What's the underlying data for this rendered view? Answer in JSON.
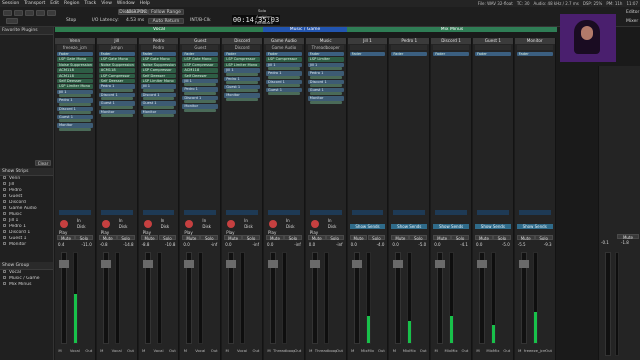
{
  "menu": [
    "Session",
    "Transport",
    "Edit",
    "Region",
    "Track",
    "View",
    "Window",
    "Help"
  ],
  "status": {
    "file": "File: WAV 32-float",
    "tc": "TC: 30",
    "audio": "Audio: 48 kHz / 2.7 ms",
    "dsp": "DSP: 25%",
    "pm": "PM: 11h",
    "time": "11:07"
  },
  "transport": {
    "stop_label": "Stop",
    "io_latency_label": "I/O Latency:",
    "disable_pdc": "Disable PDC",
    "latency1": "42.33 ms",
    "latency2": "4.53 ms",
    "follow_range": "Follow Range",
    "auto_return": "Auto Return",
    "int_label": "INT/B-Clk",
    "clock": "00:14:35:03",
    "solo": "Solo",
    "audition": "Audition",
    "feedback": "Feedback",
    "editor": "Editor",
    "mixer": "Mixer"
  },
  "sidebar": {
    "plugins_head": "Favorite Plugins",
    "clear": "Clear",
    "strips_head": "Show Strips",
    "strips": [
      "Venn",
      "Jill",
      "Pedro",
      "Guest",
      "Discord",
      "Game Audio",
      "Music",
      "Jill 1",
      "Pedro 1",
      "Discord 1",
      "Guest 1",
      "Monitor"
    ],
    "groups_head": "Show Group",
    "groups": [
      "Vocal",
      "Music / Game",
      "Mix Minus"
    ]
  },
  "groups": [
    {
      "name": "Vocal",
      "color": "#2e7d4f"
    },
    {
      "name": "Music / Game",
      "color": "#2255b0"
    },
    {
      "name": "Mix Minus",
      "color": "#2f7d55"
    }
  ],
  "strips": [
    {
      "name": "Venn",
      "input": "freeeze_jcm",
      "procs": [
        "Fader",
        "LSP Gate Mono",
        "Noise Suppression",
        "ACM118",
        "ACM118",
        "Self Deesser",
        "LSP Limiter Mono",
        "Jill 1",
        "Pedro 1",
        "Discord 1",
        "Guest 1",
        "Monitor"
      ],
      "gain": "0.4",
      "peak": "-11.0",
      "bottom": "Vocal",
      "meter": 0.55
    },
    {
      "name": "Jill",
      "input": "jsmpn",
      "procs": [
        "Fader",
        "LSP Gate Mono",
        "Noise Suppression",
        "ACM118",
        "LSP Compressor",
        "Self Deesser",
        "Pedro 1",
        "Discord 1",
        "Guest 1",
        "Monitor"
      ],
      "gain": "-0.8",
      "peak": "-14.8",
      "bottom": "Vocal",
      "meter": 0.0
    },
    {
      "name": "Pedro",
      "input": "Pedro",
      "procs": [
        "Fader",
        "LSP Gate Mono",
        "Noise Suppression",
        "LSP Compressor",
        "Self Deesser",
        "LSP Limiter Mono",
        "Jill 1",
        "Discord 1",
        "Guest 1",
        "Monitor"
      ],
      "gain": "-8.8",
      "peak": "-10.8",
      "bottom": "Vocal",
      "meter": 0.0
    },
    {
      "name": "Guest",
      "input": "Guest",
      "procs": [
        "Fader",
        "LSP Gate Mono",
        "LSP Compressor",
        "ACM118",
        "Self Deesser",
        "Jill 1",
        "Pedro 1",
        "Discord 1",
        "Monitor"
      ],
      "gain": "0.0",
      "peak": "-inf",
      "bottom": "Vocal",
      "meter": 0.0
    },
    {
      "name": "Discord",
      "input": "Discord",
      "procs": [
        "Fader",
        "LSP Compressor",
        "LSP Limiter Mono",
        "Jill 1",
        "Pedro 1",
        "Guest 1",
        "Monitor"
      ],
      "gain": "0.0",
      "peak": "-inf",
      "bottom": "Vocal",
      "meter": 0.0
    },
    {
      "name": "Game Audio",
      "input": "Game Audio",
      "procs": [
        "Fader",
        "LSP Compressor",
        "Jill 1",
        "Pedro 1",
        "Discord 1",
        "Guest 1"
      ],
      "gain": "0.0",
      "peak": "-inf",
      "bottom": "Threadbooper",
      "meter": 0.0
    },
    {
      "name": "Music",
      "input": "Threadbooper",
      "procs": [
        "Fader",
        "LSP Limiter",
        "Jill 1",
        "Pedro 1",
        "Discord 1",
        "Guest 1",
        "Monitor"
      ],
      "gain": "0.0",
      "peak": "-inf",
      "bottom": "Threadbooper",
      "meter": 0.0
    },
    {
      "name": "Jill 1",
      "input": "",
      "procs": [
        "Fader"
      ],
      "gain": "0.0",
      "peak": "-4.0",
      "bottom": "MixMix",
      "meter": 0.3
    },
    {
      "name": "Pedro 1",
      "input": "",
      "procs": [
        "Fader"
      ],
      "gain": "0.0",
      "peak": "-5.0",
      "bottom": "MixMix",
      "meter": 0.25
    },
    {
      "name": "Discord 1",
      "input": "",
      "procs": [
        "Fader"
      ],
      "gain": "0.0",
      "peak": "-4.1",
      "bottom": "MixMix",
      "meter": 0.3
    },
    {
      "name": "Guest 1",
      "input": "",
      "procs": [
        "Fader"
      ],
      "gain": "0.0",
      "peak": "-5.0",
      "bottom": "MixMix",
      "meter": 0.2
    },
    {
      "name": "Monitor",
      "input": "",
      "procs": [
        "Fader"
      ],
      "gain": "-5.5",
      "peak": "-9.3",
      "bottom": "freeeze_jcm",
      "meter": 0.35
    }
  ],
  "strip_controls": {
    "mute": "Mute",
    "solo": "Solo",
    "disk": "Disk",
    "in": "In",
    "show_sends": "Show Sends",
    "send": "Send",
    "play": "Play",
    "m": "M",
    "out": "Out"
  },
  "master": {
    "name": "Mute",
    "gain": "-0.1",
    "peak": "-1.8"
  }
}
